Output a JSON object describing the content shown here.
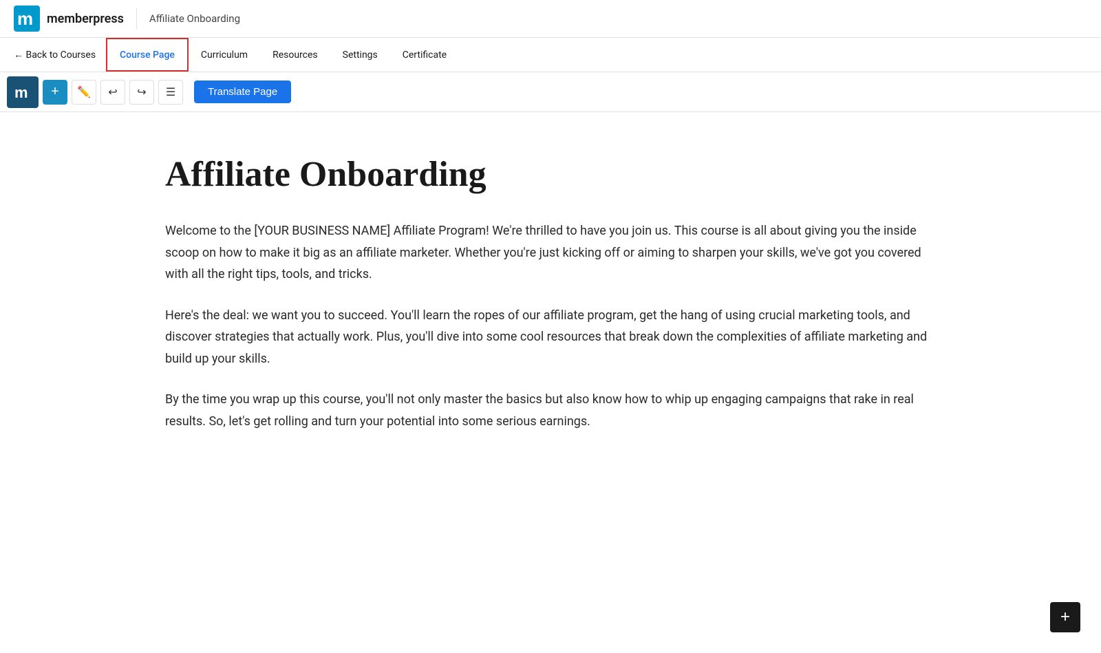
{
  "header": {
    "brand_name": "memberpress",
    "course_title": "Affiliate Onboarding"
  },
  "nav": {
    "back_label": "← Back to Courses",
    "tabs": [
      {
        "id": "course-page",
        "label": "Course Page",
        "active": true
      },
      {
        "id": "curriculum",
        "label": "Curriculum",
        "active": false
      },
      {
        "id": "resources",
        "label": "Resources",
        "active": false
      },
      {
        "id": "settings",
        "label": "Settings",
        "active": false
      },
      {
        "id": "certificate",
        "label": "Certificate",
        "active": false
      }
    ]
  },
  "toolbar": {
    "add_label": "+",
    "translate_label": "Translate Page",
    "undo_icon": "undo-icon",
    "redo_icon": "redo-icon",
    "edit_icon": "edit-icon",
    "list_icon": "list-icon"
  },
  "content": {
    "heading": "Affiliate Onboarding",
    "paragraphs": [
      "Welcome to the [YOUR BUSINESS NAME] Affiliate Program! We're thrilled to have you join us. This course is all about giving you the inside scoop on how to make it big as an affiliate marketer. Whether you're just kicking off or aiming to sharpen your skills, we've got you covered with all the right tips, tools, and tricks.",
      "Here's the deal: we want you to succeed. You'll learn the ropes of our affiliate program, get the hang of using crucial marketing tools, and discover strategies that actually work. Plus, you'll dive into some cool resources that break down the complexities of affiliate marketing and build up your skills.",
      "By the time you wrap up this course, you'll not only master the basics but also know how to whip up engaging campaigns that rake in real results. So, let's get rolling and turn your potential into some serious earnings."
    ]
  },
  "bottom_add_label": "+"
}
